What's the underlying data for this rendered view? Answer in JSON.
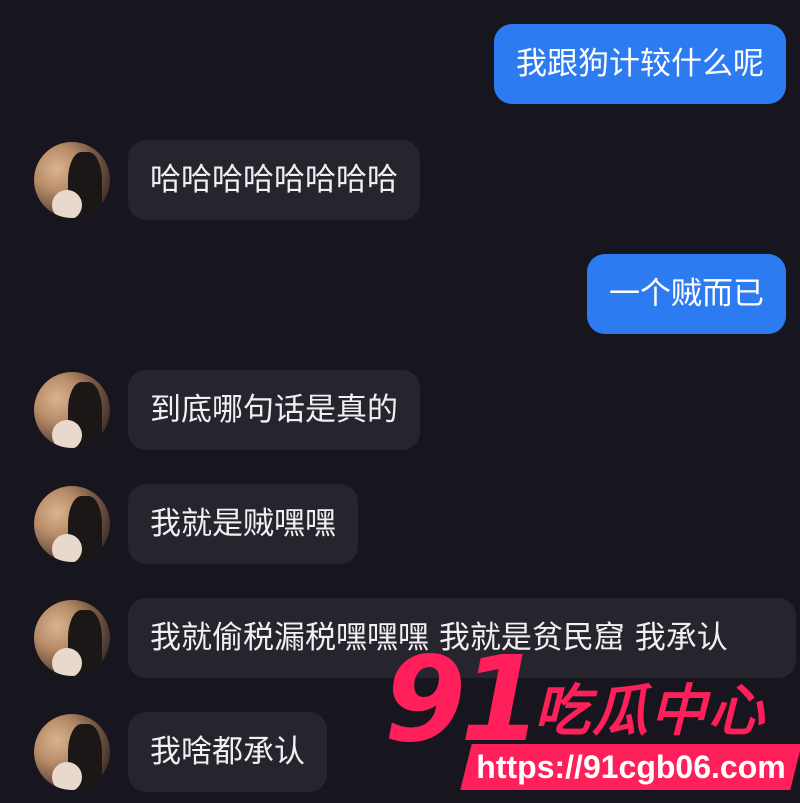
{
  "messages": [
    {
      "side": "sent",
      "text": "我跟狗计较什么呢"
    },
    {
      "side": "received",
      "text": "哈哈哈哈哈哈哈哈"
    },
    {
      "side": "sent",
      "text": "一个贼而已"
    },
    {
      "side": "received",
      "text": "到底哪句话是真的"
    },
    {
      "side": "received",
      "text": "我就是贼嘿嘿"
    },
    {
      "side": "received",
      "text": "我就偷税漏税嘿嘿嘿 我就是贫民窟 我承认"
    },
    {
      "side": "received",
      "text": "我啥都承认"
    }
  ],
  "watermark": {
    "number": "91",
    "title": "吃瓜中心",
    "url": "https://91cgb06.com"
  },
  "colors": {
    "background": "#17161e",
    "sent_bubble": "#2d7bf1",
    "received_bubble": "#26252d",
    "watermark": "#ff1f5a"
  }
}
